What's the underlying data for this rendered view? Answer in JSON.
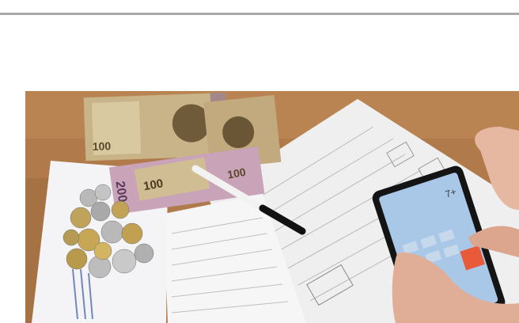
{
  "photo": {
    "banknotes": [
      {
        "denomination": "100",
        "color": "#c9b48a"
      },
      {
        "denomination": "100",
        "color": "#c2a97e"
      },
      {
        "denomination": "200",
        "color": "#c9a3b8"
      },
      {
        "denomination": "100",
        "color": "#c9b48a"
      }
    ],
    "phone_display": "7+",
    "colors": {
      "table": "#b07a4a",
      "paper": "#f2f2f2",
      "phone_screen": "#a9c7e6",
      "skin": "#e6b7a1"
    }
  }
}
